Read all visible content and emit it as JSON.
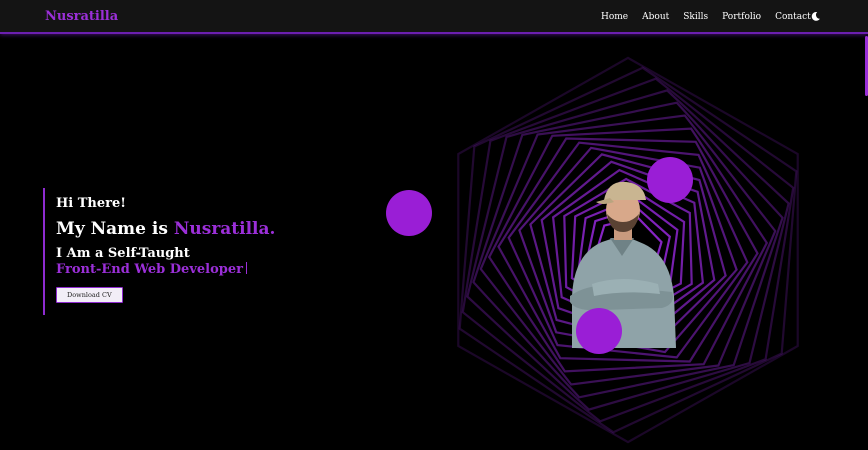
{
  "nav": {
    "brand": "Nusratilla",
    "links": [
      "Home",
      "About",
      "Skills",
      "Portfolio",
      "Contact"
    ],
    "theme_toggle_icon": "moon-icon"
  },
  "hero": {
    "greeting": "Hi There!",
    "name_prefix": "My Name is ",
    "name": "Nusratilla.",
    "tagline": "I Am a Self-Taught",
    "role": "Front-End Web Developer",
    "download_label": "Download CV"
  },
  "colors": {
    "accent": "#9b2fd8",
    "navbar_bg": "#141414",
    "page_bg": "#000000"
  }
}
